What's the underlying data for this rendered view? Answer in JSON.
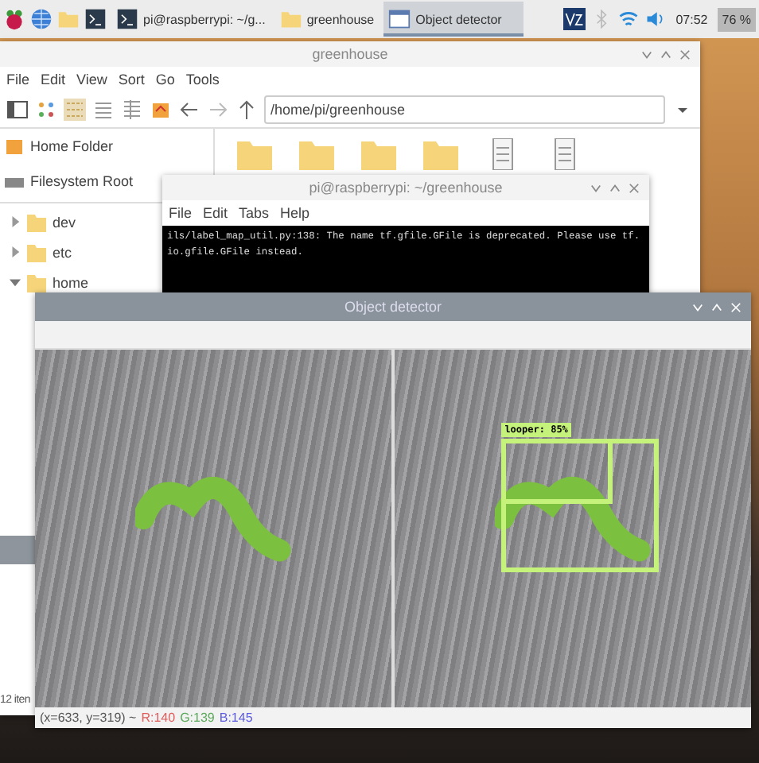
{
  "taskbar": {
    "tasks": [
      {
        "label": "pi@raspberrypi: ~/g...",
        "selected": false
      },
      {
        "label": "greenhouse",
        "selected": false
      },
      {
        "label": "Object detector",
        "selected": true
      }
    ],
    "clock": "07:52",
    "cpu": "76 %"
  },
  "file_manager": {
    "title": "greenhouse",
    "menu": [
      "File",
      "Edit",
      "View",
      "Sort",
      "Go",
      "Tools"
    ],
    "path": "/home/pi/greenhouse",
    "places": [
      "Home Folder",
      "Filesystem Root"
    ],
    "tree": [
      {
        "label": "dev",
        "expanded": false
      },
      {
        "label": "etc",
        "expanded": false
      },
      {
        "label": "home",
        "expanded": true
      }
    ],
    "status": "12 iten"
  },
  "terminal": {
    "title": "pi@raspberrypi: ~/greenhouse",
    "menu": [
      "File",
      "Edit",
      "Tabs",
      "Help"
    ],
    "lines": [
      "ils/label_map_util.py:138: The name tf.gfile.GFile is deprecated. Please use tf.",
      "io.gfile.GFile instead."
    ]
  },
  "object_detector": {
    "title": "Object detector",
    "detections": [
      {
        "label": "looper: 85%"
      }
    ],
    "pixel_info": {
      "coords": "(x=633, y=319) ~",
      "r": "R:140",
      "g": "G:139",
      "b": "B:145"
    }
  }
}
